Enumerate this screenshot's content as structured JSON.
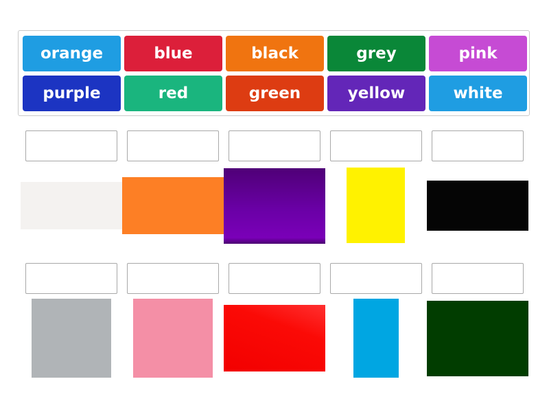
{
  "word_bank": {
    "tiles": [
      {
        "label": "orange",
        "color": "#1f9de2"
      },
      {
        "label": "blue",
        "color": "#dc1f3a"
      },
      {
        "label": "black",
        "color": "#f07410"
      },
      {
        "label": "grey",
        "color": "#0a8738"
      },
      {
        "label": "pink",
        "color": "#c64bd4"
      },
      {
        "label": "purple",
        "color": "#1c34c2"
      },
      {
        "label": "red",
        "color": "#1ab57e"
      },
      {
        "label": "green",
        "color": "#dd3c12"
      },
      {
        "label": "yellow",
        "color": "#6326b8"
      },
      {
        "label": "white",
        "color": "#1f9de2"
      }
    ]
  },
  "targets": [
    {
      "name": "white-swatch",
      "color": "#f4f2f0"
    },
    {
      "name": "orange-swatch",
      "color": "#fd7f25"
    },
    {
      "name": "purple-swatch",
      "color": "#6a00a6"
    },
    {
      "name": "yellow-swatch",
      "color": "#fff200"
    },
    {
      "name": "black-swatch",
      "color": "#050505"
    },
    {
      "name": "grey-swatch",
      "color": "#b0b4b7"
    },
    {
      "name": "pink-swatch",
      "color": "#f48fa6"
    },
    {
      "name": "red-swatch",
      "color": "#fb0a06"
    },
    {
      "name": "blue-swatch",
      "color": "#00a6e2"
    },
    {
      "name": "green-swatch",
      "color": "#013d00"
    }
  ]
}
